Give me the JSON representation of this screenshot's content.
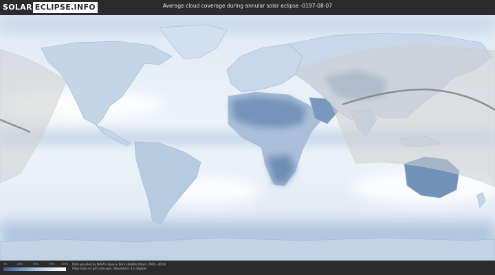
{
  "header": {
    "logo_left": "SOLAR",
    "logo_right": "ECLIPSE.INFO",
    "title": "Average cloud coverage during annular solar eclipse -0197-08-07"
  },
  "legend": {
    "tick_labels": [
      "0%",
      "25%",
      "50%",
      "75%",
      "100%"
    ],
    "colors": [
      "#3a5f8e",
      "#6c8fb8",
      "#a8c0da",
      "#d9e5f1",
      "#ffffff"
    ]
  },
  "credits": {
    "line1": "Data provided by NASA's Aqua & Terra satellite (Years: 2000 - 2019)",
    "line2": "https://neo.sci.gsfc.nasa.gov | Resolution: 0.1 degrees"
  },
  "map": {
    "ocean_color": "#e9f1f8",
    "cloud_low_color": "#ffffff",
    "cloud_high_color": "#5b7fa9",
    "eclipse_zone_fill": "#d4d4d4",
    "eclipse_path_color": "#808080"
  }
}
